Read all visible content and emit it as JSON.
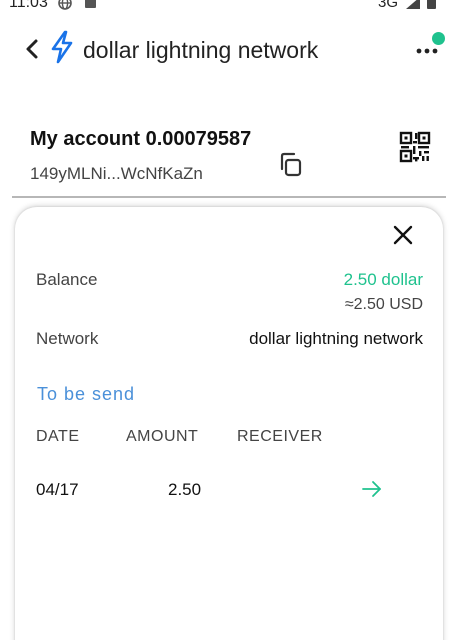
{
  "status_bar": {
    "time": "11:03",
    "network": "3G"
  },
  "header": {
    "title": "dollar lightning network",
    "icons": {
      "back": "chevron-left-icon",
      "logo": "lightning-bolt-icon",
      "more": "more-dots-icon"
    },
    "accent_color": "#1a73e8",
    "notification_dot_color": "#1fc28e"
  },
  "account": {
    "title": "My account 0.00079587",
    "address": "149yMLNi...WcNfKaZn",
    "icons": {
      "copy": "copy-icon",
      "qr": "qr-code-icon"
    }
  },
  "detail_sheet": {
    "balance_label": "Balance",
    "balance_value": "2.50 dollar",
    "balance_fiat": "≈2.50 USD",
    "network_label": "Network",
    "network_value": "dollar lightning network",
    "section_title": "To be send",
    "columns": {
      "date": "DATE",
      "amount": "AMOUNT",
      "receiver": "RECEIVER"
    },
    "transactions": [
      {
        "date": "04/17",
        "amount": "2.50",
        "receiver_icon": "arrow-right-icon"
      }
    ],
    "colors": {
      "positive": "#1fc28e",
      "link": "#4a90d9"
    }
  }
}
